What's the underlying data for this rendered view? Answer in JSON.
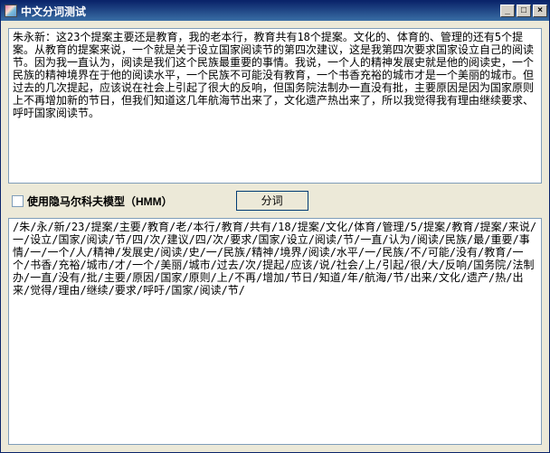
{
  "window": {
    "title": "中文分词测试"
  },
  "input": {
    "text": "朱永新：这23个提案主要还是教育，我的老本行，教育共有18个提案。文化的、体育的、管理的还有5个提案。从教育的提案来说，一个就是关于设立国家阅读节的第四次建议，这是我第四次要求国家设立自己的阅读节。因为我一直认为，阅读是我们这个民族最重要的事情。我说，一个人的精神发展史就是他的阅读史，一个民族的精神境界在于他的阅读水平，一个民族不可能没有教育，一个书香充裕的城市才是一个美丽的城市。但过去的几次提起，应该说在社会上引起了很大的反响，但国务院法制办一直没有批，主要原因是因为国家原则上不再增加新的节日，但我们知道这几年航海节出来了，文化遗产热出来了，所以我觉得我有理由继续要求、呼吁国家阅读节。"
  },
  "controls": {
    "hmm_label": "使用隐马尔科夫模型（HMM）",
    "segment_button": "分词"
  },
  "output": {
    "text": "/朱/永/新/23/提案/主要/教育/老/本行/教育/共有/18/提案/文化/体育/管理/5/提案/教育/提案/来说/一/设立/国家/阅读/节/四/次/建议/四/次/要求/国家/设立/阅读/节/一直/认为/阅读/民族/最/重要/事情/一/一个/人/精神/发展史/阅读/史/一/民族/精神/境界/阅读/水平/一/民族/不/可能/没有/教育/一个/书香/充裕/城市/才/一个/美丽/城市/过去/次/提起/应该/说/社会/上/引起/很/大/反响/国务院/法制办/一直/没有/批/主要/原因/国家/原则/上/不再/增加/节日/知道/年/航海/节/出来/文化/遗产/热/出来/觉得/理由/继续/要求/呼吁/国家/阅读/节/"
  }
}
